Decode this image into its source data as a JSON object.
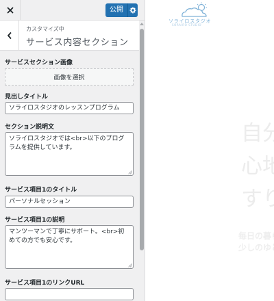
{
  "topbar": {
    "close_icon": "close-icon",
    "publish_label": "公開",
    "publish_settings_icon": "gear-icon"
  },
  "section": {
    "back_icon": "chevron-left-icon",
    "breadcrumb": "カスタマイズ中",
    "title": "サービス内容セクション"
  },
  "controls": {
    "section_image_label": "サービスセクション画像",
    "select_image_button": "画像を選択",
    "heading_title_label": "見出しタイトル",
    "heading_title_value": "ソライロスタジオのレッスンプログラム",
    "description_label": "セクション説明文",
    "description_value": "ソライロスタジオでは<br>以下のプログラムを提供しています。",
    "service1_title_label": "サービス項目1のタイトル",
    "service1_title_value": "パーソナルセッション",
    "service1_desc_label": "サービス項目1の説明",
    "service1_desc_value": "マンツーマンで丁寧にサポート。<br>初めての方でも安心です。",
    "service1_link_label": "サービス項目1のリンクURL",
    "service1_link_value": ""
  },
  "preview": {
    "logo_text": "ソライロスタジオ",
    "logo_sub": "SORAIRO STUDIO",
    "hero_lines": [
      "自分",
      "心地",
      "すり"
    ],
    "hero_sub_lines": [
      "毎日の暮ら",
      "少しのゆと"
    ]
  },
  "colors": {
    "accent": "#2271b1",
    "panel_bg": "#f0f0f1",
    "logo": "#7fb2d8"
  }
}
